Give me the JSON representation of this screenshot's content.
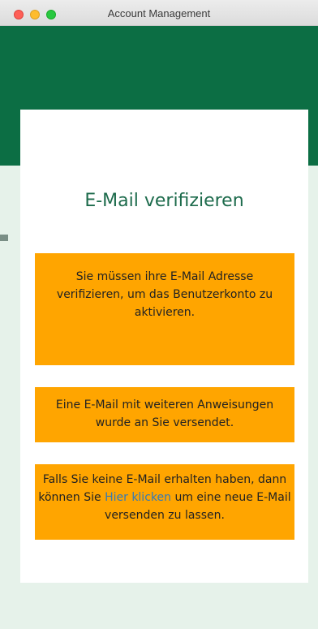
{
  "window": {
    "title": "Account Management"
  },
  "card": {
    "title": "E-Mail verifizieren",
    "notice1": "Sie müssen ihre E-Mail Adresse verifizieren, um das Benutzerkonto zu aktivieren.",
    "notice2": "Eine E-Mail mit weiteren Anweisungen wurde an Sie versendet.",
    "notice3_before": "Falls Sie keine E-Mail erhalten haben, dann können Sie ",
    "notice3_link": "Hier klicken",
    "notice3_after": " um eine neue E-Mail versenden zu lassen."
  },
  "colors": {
    "hero": "#0c6e44",
    "background": "#e6f2ea",
    "notice": "#ffa500",
    "title": "#1d6b4c",
    "link": "#337ab7"
  }
}
